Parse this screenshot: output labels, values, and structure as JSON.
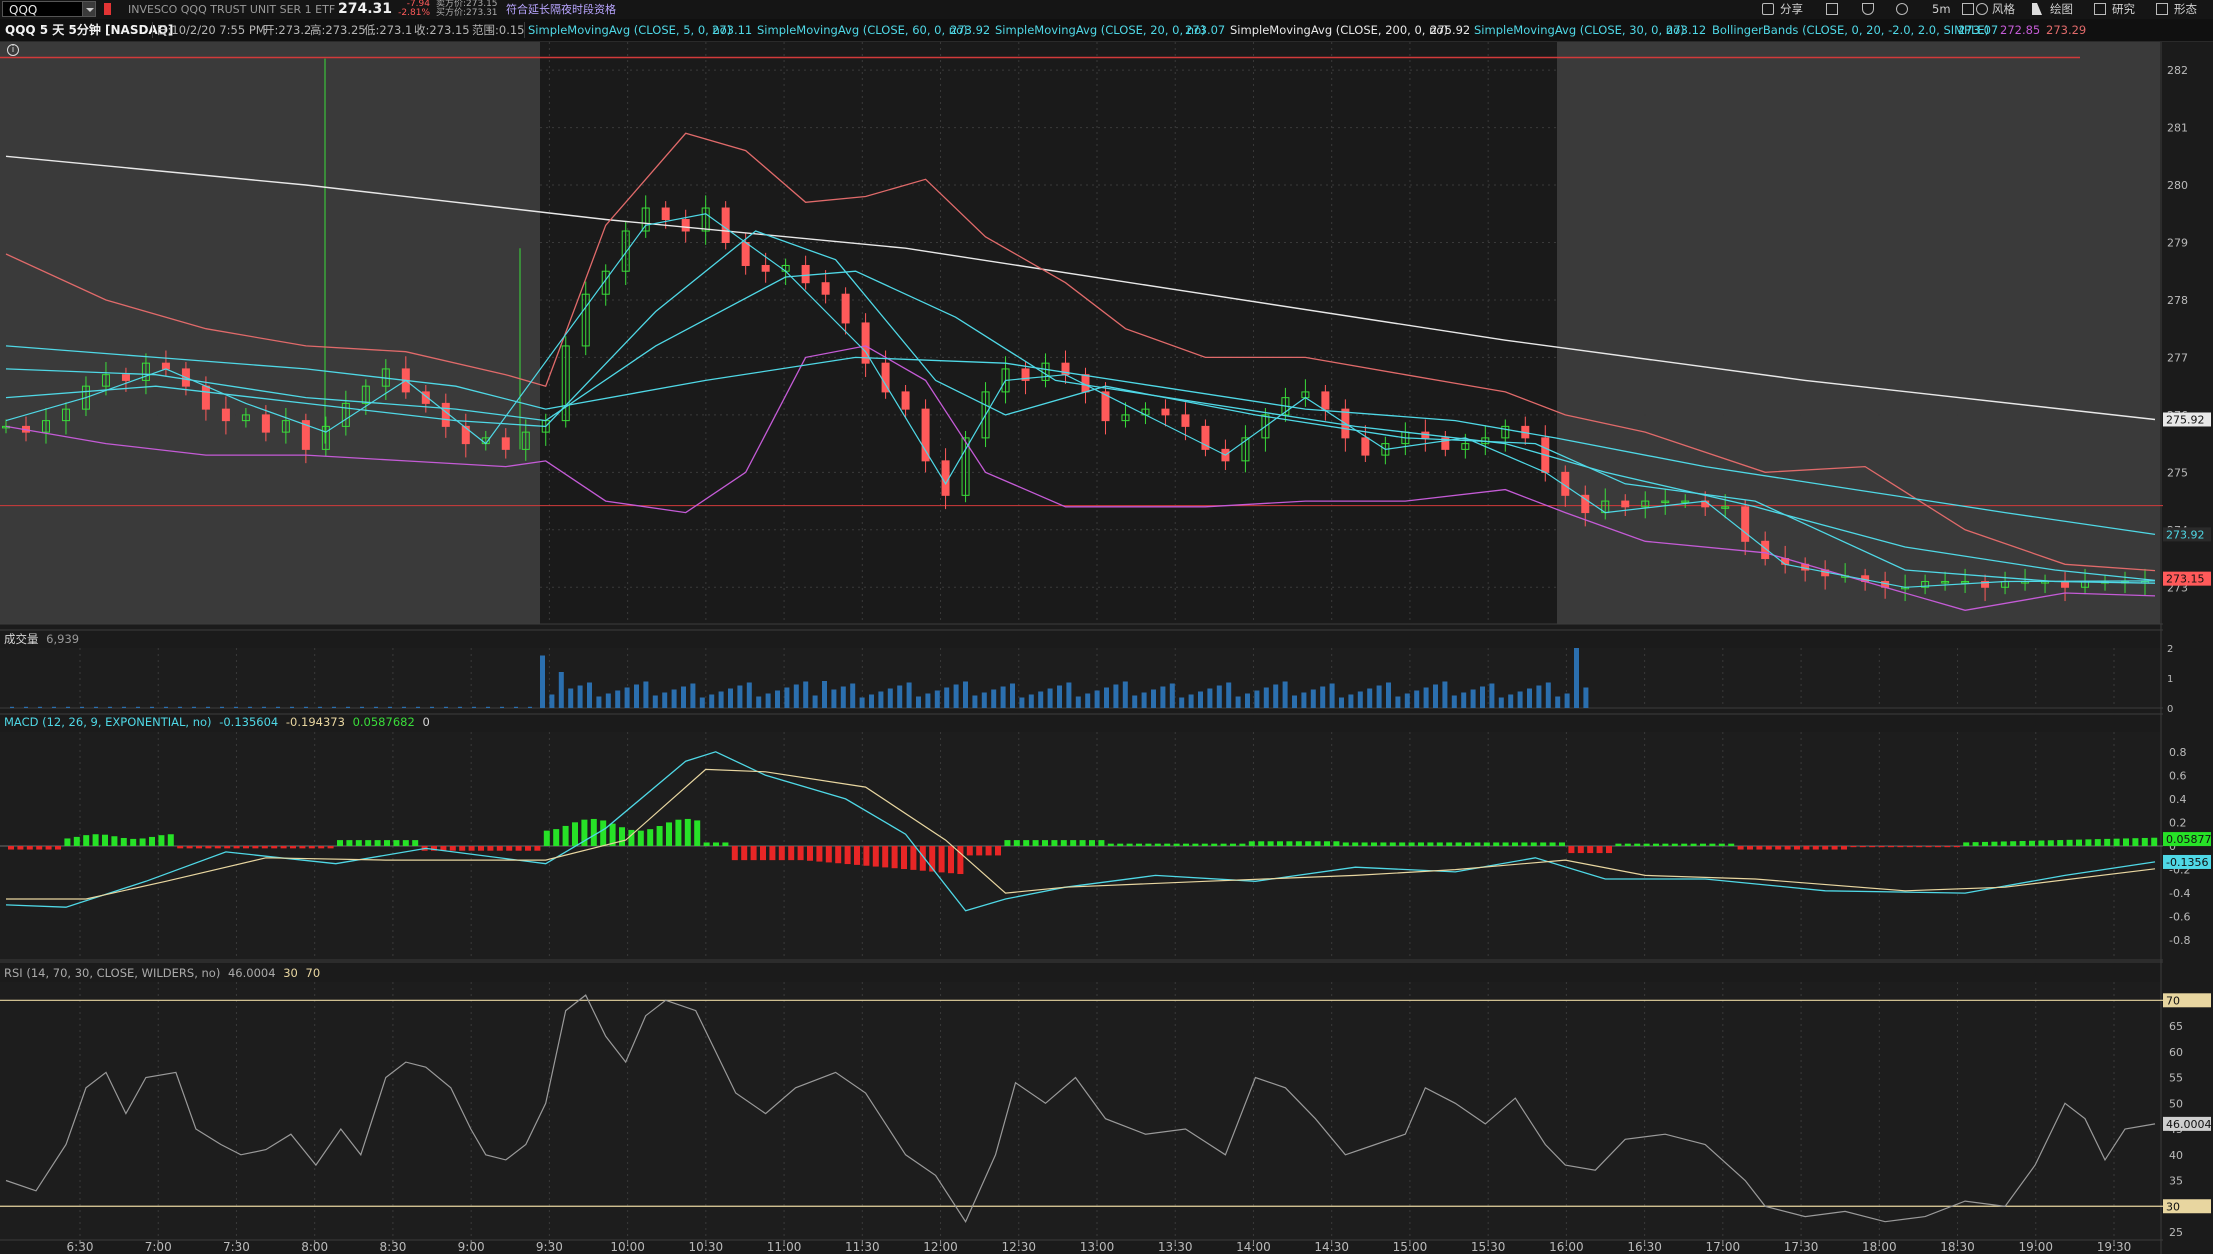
{
  "symbol": "QQQ",
  "instrument": "INVESCO QQQ TRUST UNIT SER 1 ETF",
  "last_price": "274.31",
  "change": "-7.94",
  "change_pct": "-2.81%",
  "bid_line": "卖方价:273.15",
  "ask_line": "买方价:273.31",
  "extended_hours": "符合延长隔夜时段资格",
  "toolbar": {
    "share": "分享",
    "timeframe": "5m",
    "style": "风格",
    "drawings": "绘图",
    "studies": "研究",
    "patterns": "形态"
  },
  "chart_title": "QQQ 5 天 5分钟 [NASDAQ]",
  "ohlc": {
    "date": "日:10/2/20 7:55 PM",
    "open": "开:273.2",
    "high": "高:273.25",
    "low": "低:273.1",
    "close": "收:273.15",
    "range": "范围:0.15"
  },
  "studies": [
    {
      "label": "SimpleMovingAvg (CLOSE, 5, 0, no)",
      "value": "273.11",
      "color": "#4fd8e6"
    },
    {
      "label": "SimpleMovingAvg (CLOSE, 60, 0, no)",
      "value": "273.92",
      "color": "#4fd8e6"
    },
    {
      "label": "SimpleMovingAvg (CLOSE, 20, 0, no)",
      "value": "273.07",
      "color": "#4fd8e6"
    },
    {
      "label": "SimpleMovingAvg (CLOSE, 200, 0, no)",
      "value": "275.92",
      "color": "#e8e8e8"
    },
    {
      "label": "SimpleMovingAvg (CLOSE, 30, 0, no)",
      "value": "273.12",
      "color": "#4fd8e6"
    },
    {
      "label": "BollingerBands (CLOSE, 0, 20, -2.0, 2.0, SIMPLE)",
      "value": "273.07",
      "value2": "272.85",
      "value3": "273.29",
      "color": "#4fd8e6"
    }
  ],
  "price_axis": {
    "ticks": [
      "282",
      "281",
      "280",
      "279",
      "278",
      "277",
      "276",
      "275",
      "274",
      "273"
    ],
    "badge_200": "275.92",
    "badge_60": "273.92",
    "badge_last": "273.15"
  },
  "volume": {
    "label": "成交量",
    "value": "6,939",
    "ticks": [
      "2",
      "1",
      "0"
    ]
  },
  "macd": {
    "label": "MACD (12, 26, 9, EXPONENTIAL, no)",
    "v1": "-0.135604",
    "v2": "-0.194373",
    "v3": "0.0587682",
    "v4": "0",
    "ticks": [
      "0.8",
      "0.6",
      "0.4",
      "0.2",
      "0",
      "-0.2",
      "-0.4",
      "-0.6",
      "-0.8"
    ],
    "badge_hist": "0.05877",
    "badge_macd": "-0.1356"
  },
  "rsi": {
    "label": "RSI (14, 70, 30, CLOSE, WILDERS, no)",
    "value": "46.0004",
    "ob": "30",
    "os": "70",
    "ticks": [
      "70",
      "65",
      "60",
      "55",
      "50",
      "45",
      "40",
      "35",
      "30",
      "25"
    ],
    "badge_ob": "70",
    "badge_value": "46.0004",
    "badge_os": "30"
  },
  "time_axis": [
    "6:30",
    "7:00",
    "7:30",
    "8:00",
    "8:30",
    "9:00",
    "9:30",
    "10:00",
    "10:30",
    "11:00",
    "11:30",
    "12:00",
    "12:30",
    "13:00",
    "13:30",
    "14:00",
    "14:30",
    "15:00",
    "15:30",
    "16:00",
    "16:30",
    "17:00",
    "17:30",
    "18:00",
    "18:30",
    "19:00",
    "19:30"
  ],
  "colors": {
    "up": "#3adc3a",
    "down": "#ff5a5a",
    "cyan": "#4fd8e6",
    "bb": "#c45bd6",
    "bbUpper": "#e06a6a",
    "sma200": "#e8e8e8",
    "session": "#1a1a1a",
    "ext": "#3a3a3a",
    "macdHistUp": "#27e227",
    "macdHistDn": "#e82626",
    "signal": "#e8d6a0"
  }
}
